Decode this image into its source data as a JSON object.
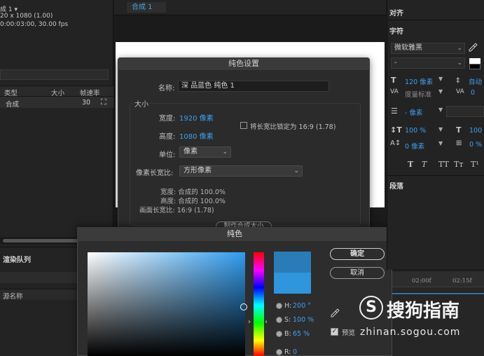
{
  "project_panel": {
    "comp_info_1": "成 1 ▾",
    "comp_info_2": "20 x 1080 (1.00)",
    "comp_info_3": "0:00:03:00, 30.00 fps",
    "columns": [
      "类型",
      "大小",
      "帧速率"
    ],
    "row": {
      "type": "合成",
      "fps": "30"
    }
  },
  "render_queue": {
    "tab_label": "渲染队列",
    "source_header": "源名称"
  },
  "viewer": {
    "tab_label": "合成 1"
  },
  "solid_settings": {
    "title": "纯色设置",
    "name_label": "名称:",
    "name_value": "深 品蓝色 纯色 1",
    "size_group_label": "大小",
    "width_label": "宽度:",
    "width_value": "1920 像素",
    "height_label": "高度:",
    "height_value": "1080 像素",
    "lock_label": "将长宽比锁定为 16:9 (1.78)",
    "units_label": "单位:",
    "units_value": "像素",
    "pixel_aspect_label": "像素长宽比:",
    "pixel_aspect_value": "方形像素",
    "info_width": "宽度: 合成的 100.0%",
    "info_height": "高度: 合成的 100.0%",
    "info_frame_aspect": "画面长宽比: 16:9 (1.78)",
    "make_comp_size": "制作合成大小"
  },
  "color_picker": {
    "title": "纯色",
    "ok_label": "确定",
    "cancel_label": "取消",
    "h_label": "H:",
    "h_value": "200 °",
    "s_label": "S:",
    "s_value": "100 %",
    "b_label": "B:",
    "b_value": "65 %",
    "r_label": "R:",
    "r_value": "0",
    "preview_label": "预览",
    "preview_checked": true,
    "new_color": "#2a7cb8",
    "old_color": "#2f95dc"
  },
  "character_panel": {
    "align_header": "对齐",
    "character_header": "字符",
    "font_family": "微软雅黑",
    "font_style": "-",
    "font_size": "120 像素",
    "leading": "自动",
    "kerning": "度量标准",
    "tracking": "0",
    "stroke_width": "- 像素",
    "vertical_scale": "100 %",
    "horizontal_scale": "100",
    "baseline_shift": "0 像素",
    "tsume": "0 %",
    "style_buttons": [
      "T",
      "T",
      "TT",
      "Tт",
      "T¹"
    ],
    "paragraph_header": "段落"
  },
  "timeline": {
    "ticks": [
      "02:00f",
      "02:15f"
    ]
  },
  "watermark": {
    "logo_char": "S",
    "brand": "搜狗指南",
    "url": "zhinan.sogou.com"
  }
}
